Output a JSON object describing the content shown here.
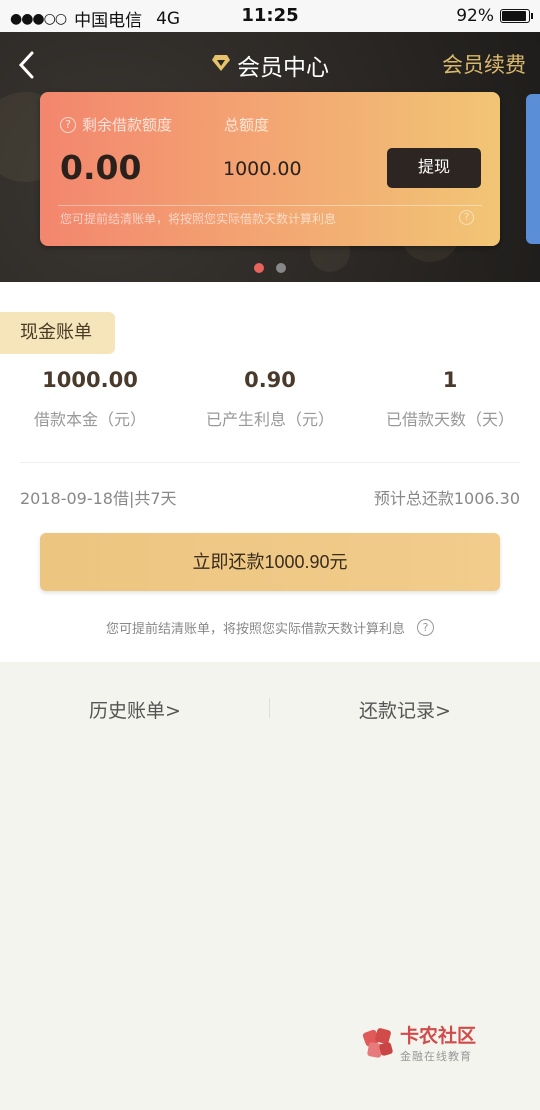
{
  "status_bar": {
    "signal": "●●●○○",
    "carrier": "中国电信",
    "network": "4G",
    "time": "11:25",
    "battery": "92%",
    "battery_level": 0.92
  },
  "header": {
    "title": "会员中心",
    "right_action": "会员续费",
    "accent_color": "#d8b86a"
  },
  "card": {
    "remaining_label": "剩余借款额度",
    "total_label": "总额度",
    "remaining_value": "0.00",
    "total_value": "1000.00",
    "withdraw_label": "提现",
    "note": "您可提前结清账单，将按照您实际借款天数计算利息"
  },
  "bill": {
    "tag": "现金账单",
    "stats": [
      {
        "value": "1000.00",
        "label": "借款本金（元）"
      },
      {
        "value": "0.90",
        "label": "已产生利息（元）"
      },
      {
        "value": "1",
        "label": "已借款天数（天）"
      }
    ],
    "date_info": "2018-09-18借|共7天",
    "due_info": "预计总还款1006.30",
    "repay_button": "立即还款1000.90元",
    "note": "您可提前结清账单，将按照您实际借款天数计算利息"
  },
  "links": {
    "history": "历史账单>",
    "records": "还款记录>"
  },
  "watermark": {
    "brand": "卡农社区",
    "slogan": "金融在线教育"
  }
}
